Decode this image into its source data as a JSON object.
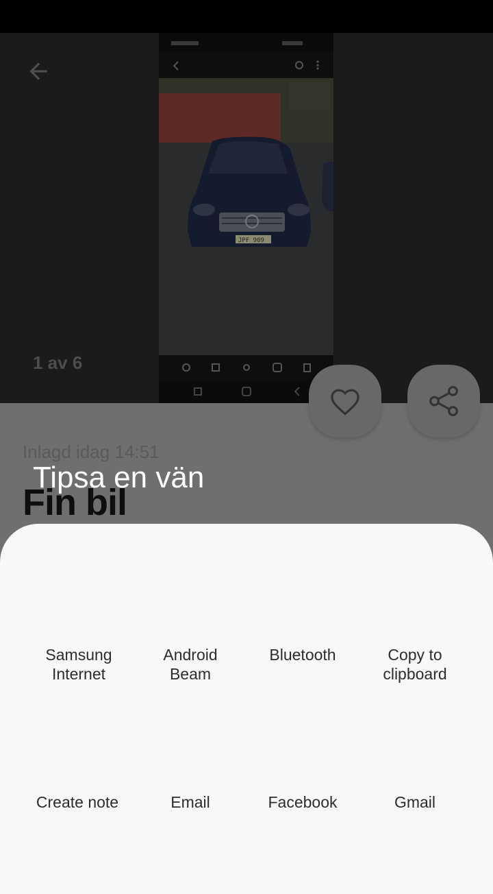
{
  "gallery": {
    "counter": "1 av 6",
    "back_icon": "arrow-left-icon",
    "photo_plate": "JPF 909"
  },
  "actions": {
    "like_icon": "heart-outline-icon",
    "share_icon": "share-icon"
  },
  "listing": {
    "posted": "Inlagd idag 14:51",
    "title": "Fin bil"
  },
  "share_sheet": {
    "title": "Tipsa en vän",
    "targets": [
      {
        "line1": "Samsung",
        "line2": "Internet"
      },
      {
        "line1": "Android",
        "line2": "Beam"
      },
      {
        "line1": "Bluetooth",
        "line2": ""
      },
      {
        "line1": "Copy to",
        "line2": "clipboard"
      },
      {
        "line1": "Create note",
        "line2": ""
      },
      {
        "line1": "Email",
        "line2": ""
      },
      {
        "line1": "Facebook",
        "line2": ""
      },
      {
        "line1": "Gmail",
        "line2": ""
      }
    ]
  },
  "colors": {
    "scrim": "#6f6f6f",
    "sheet_background": "#f8f8f8",
    "gallery_background": "#1b1b1b"
  }
}
